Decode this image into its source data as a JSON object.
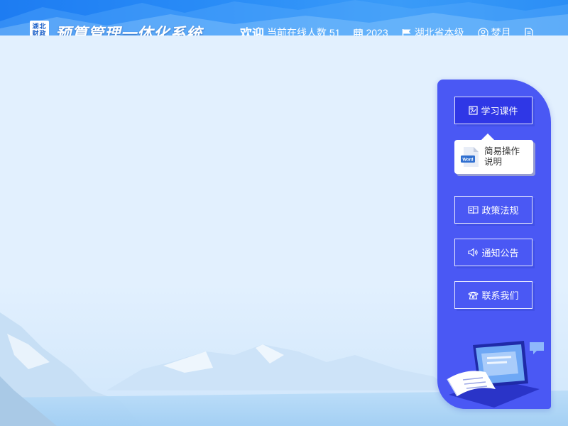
{
  "header": {
    "logo_text": "湖北财政",
    "title": "预算管理一体化系统",
    "marquee_text": "欢迎",
    "online_label": "当前在线人数 51",
    "year": "2023",
    "region": "湖北省本级",
    "user": "梦月"
  },
  "side_panel": {
    "study_button": "学习课件",
    "doc_card_label": "简易操作说明",
    "doc_badge": "Word",
    "policy_button": "政策法规",
    "notice_button": "通知公告",
    "contact_button": "联系我们"
  },
  "colors": {
    "header_blue": "#1d7cf2",
    "panel_blue": "#4a58f4",
    "active_button": "#2f37e6",
    "content_bg": "#e2f0fe"
  }
}
